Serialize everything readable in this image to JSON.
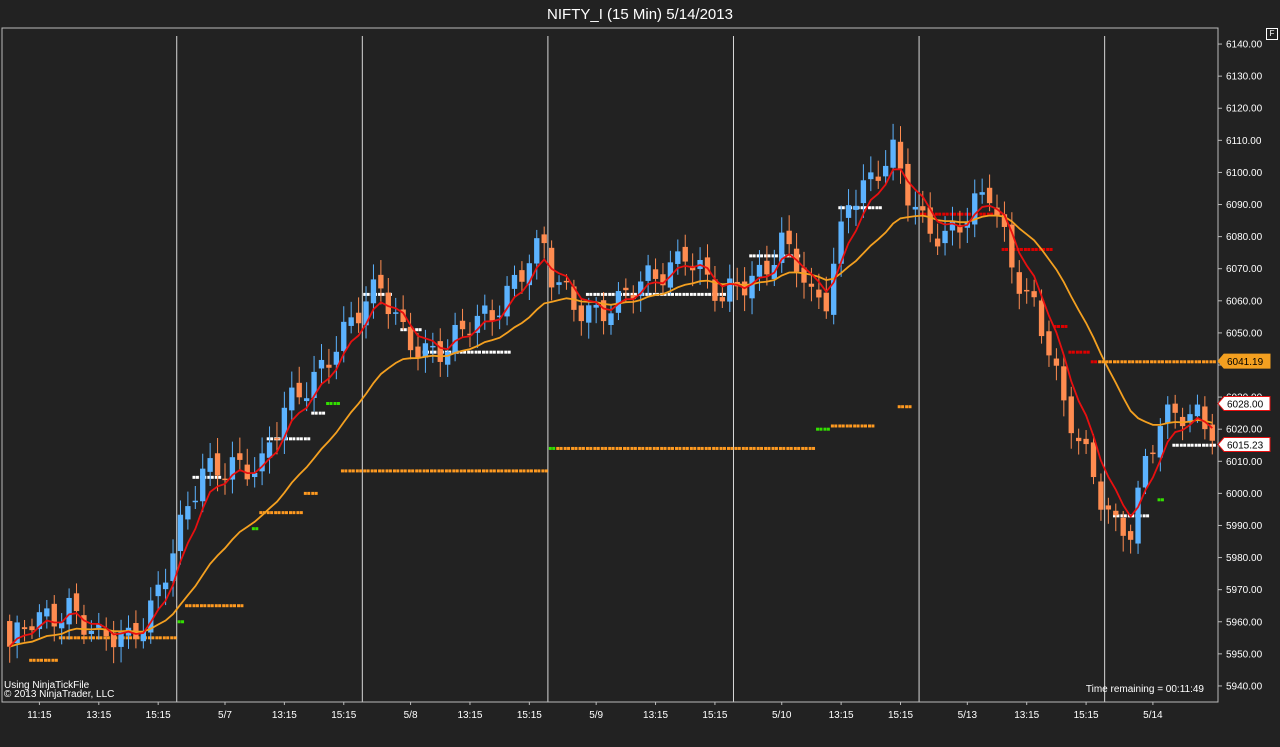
{
  "window": {
    "title": "NIFTY_I (15 Min)  5/14/2013",
    "f_button": "F"
  },
  "footer": {
    "source_line1": "Using NinjaTickFile",
    "source_line2": "© 2013 NinjaTrader, LLC",
    "time_remaining": "Time remaining = 00:11:49"
  },
  "colors": {
    "background": "#222222",
    "up_candle": "#5cb3ff",
    "down_candle": "#ff8c50",
    "ema_fast": "#e81010",
    "ema_slow": "#f4a020",
    "stop_white": "#ffffff",
    "stop_orange": "#ff9a20",
    "stop_green": "#33e000",
    "stop_red": "#e00000",
    "stop_magenta": "#e020e0"
  },
  "chart_data": {
    "type": "candlestick",
    "symbol": "NIFTY_I",
    "interval": "15 Min",
    "ylim": [
      5935,
      6145
    ],
    "y_ticks": [
      "6140.00",
      "6130.00",
      "6120.00",
      "6110.00",
      "6100.00",
      "6090.00",
      "6080.00",
      "6070.00",
      "6060.00",
      "6050.00",
      "6040.00",
      "6030.00",
      "6020.00",
      "6010.00",
      "6000.00",
      "5990.00",
      "5980.00",
      "5970.00",
      "5960.00",
      "5950.00",
      "5940.00"
    ],
    "x_labels": [
      {
        "bar": 4,
        "label": "11:15"
      },
      {
        "bar": 12,
        "label": "13:15"
      },
      {
        "bar": 20,
        "label": "15:15"
      },
      {
        "bar": 29,
        "label": "5/7"
      },
      {
        "bar": 37,
        "label": "13:15"
      },
      {
        "bar": 45,
        "label": "15:15"
      },
      {
        "bar": 54,
        "label": "5/8"
      },
      {
        "bar": 62,
        "label": "13:15"
      },
      {
        "bar": 70,
        "label": "15:15"
      },
      {
        "bar": 79,
        "label": "5/9"
      },
      {
        "bar": 87,
        "label": "13:15"
      },
      {
        "bar": 95,
        "label": "15:15"
      },
      {
        "bar": 104,
        "label": "5/10"
      },
      {
        "bar": 112,
        "label": "13:15"
      },
      {
        "bar": 120,
        "label": "15:15"
      },
      {
        "bar": 129,
        "label": "5/13"
      },
      {
        "bar": 137,
        "label": "13:15"
      },
      {
        "bar": 145,
        "label": "15:15"
      },
      {
        "bar": 154,
        "label": "5/14"
      }
    ],
    "session_breaks": [
      23,
      48,
      73,
      98,
      123,
      148
    ],
    "price_tags": [
      {
        "value": 6041.19,
        "label": "6041.19",
        "color": "#f4a020"
      },
      {
        "value": 6028.0,
        "label": "6028.00",
        "color": "#ffffff"
      },
      {
        "value": 6015.23,
        "label": "6015.23",
        "color": "#ffffff"
      }
    ],
    "key_points": [
      [
        0,
        5950
      ],
      [
        3,
        5960
      ],
      [
        8,
        5966
      ],
      [
        12,
        5953
      ],
      [
        16,
        5955
      ],
      [
        19,
        5966
      ],
      [
        22,
        5982
      ],
      [
        26,
        6005
      ],
      [
        30,
        6011
      ],
      [
        34,
        6008
      ],
      [
        37,
        6024
      ],
      [
        40,
        6034
      ],
      [
        44,
        6048
      ],
      [
        47,
        6055
      ],
      [
        50,
        6063
      ],
      [
        53,
        6052
      ],
      [
        56,
        6045
      ],
      [
        59,
        6043
      ],
      [
        62,
        6052
      ],
      [
        65,
        6058
      ],
      [
        68,
        6067
      ],
      [
        70,
        6072
      ],
      [
        72,
        6075
      ],
      [
        73,
        6066
      ],
      [
        76,
        6060
      ],
      [
        79,
        6058
      ],
      [
        82,
        6058
      ],
      [
        85,
        6064
      ],
      [
        88,
        6070
      ],
      [
        91,
        6077
      ],
      [
        94,
        6065
      ],
      [
        96,
        6058
      ],
      [
        98,
        6064
      ],
      [
        101,
        6070
      ],
      [
        104,
        6079
      ],
      [
        106,
        6071
      ],
      [
        108,
        6058
      ],
      [
        110,
        6060
      ],
      [
        113,
        6094
      ],
      [
        116,
        6098
      ],
      [
        119,
        6104
      ],
      [
        121,
        6092
      ],
      [
        123,
        6085
      ],
      [
        126,
        6082
      ],
      [
        129,
        6086
      ],
      [
        132,
        6092
      ],
      [
        135,
        6072
      ],
      [
        138,
        6060
      ],
      [
        140,
        6046
      ],
      [
        142,
        6025
      ],
      [
        145,
        6010
      ],
      [
        147,
        6000
      ],
      [
        149,
        5992
      ],
      [
        151,
        5990
      ],
      [
        153,
        6008
      ],
      [
        155,
        6020
      ],
      [
        158,
        6025
      ],
      [
        160,
        6026
      ],
      [
        162,
        6022
      ]
    ],
    "ema_fast_period": 5,
    "ema_slow_period": 20,
    "stop_segments": [
      {
        "from": 3,
        "to": 6,
        "value": 5948,
        "color": "#ff9a20"
      },
      {
        "from": 7,
        "to": 22,
        "value": 5955,
        "color": "#ff9a20"
      },
      {
        "from": 23,
        "to": 23,
        "value": 5960,
        "color": "#33e000"
      },
      {
        "from": 24,
        "to": 31,
        "value": 5965,
        "color": "#ff9a20"
      },
      {
        "from": 25,
        "to": 28,
        "value": 6005,
        "color": "#ffffff"
      },
      {
        "from": 33,
        "to": 33,
        "value": 5989,
        "color": "#33e000"
      },
      {
        "from": 34,
        "to": 39,
        "value": 5994,
        "color": "#ff9a20"
      },
      {
        "from": 40,
        "to": 41,
        "value": 6000,
        "color": "#ff9a20"
      },
      {
        "from": 35,
        "to": 40,
        "value": 6017,
        "color": "#ffffff"
      },
      {
        "from": 41,
        "to": 42,
        "value": 6025,
        "color": "#ffffff"
      },
      {
        "from": 43,
        "to": 44,
        "value": 6028,
        "color": "#33e000"
      },
      {
        "from": 45,
        "to": 72,
        "value": 6007,
        "color": "#ff9a20"
      },
      {
        "from": 48,
        "to": 51,
        "value": 6062,
        "color": "#ffffff"
      },
      {
        "from": 53,
        "to": 55,
        "value": 6051,
        "color": "#ffffff"
      },
      {
        "from": 56,
        "to": 67,
        "value": 6044,
        "color": "#ffffff"
      },
      {
        "from": 73,
        "to": 73,
        "value": 6014,
        "color": "#33e000"
      },
      {
        "from": 74,
        "to": 108,
        "value": 6014,
        "color": "#ff9a20"
      },
      {
        "from": 78,
        "to": 96,
        "value": 6062,
        "color": "#ffffff"
      },
      {
        "from": 100,
        "to": 106,
        "value": 6074,
        "color": "#ffffff"
      },
      {
        "from": 109,
        "to": 110,
        "value": 6020,
        "color": "#33e000"
      },
      {
        "from": 111,
        "to": 116,
        "value": 6021,
        "color": "#ff9a20"
      },
      {
        "from": 112,
        "to": 117,
        "value": 6089,
        "color": "#ffffff"
      },
      {
        "from": 120,
        "to": 121,
        "value": 6027,
        "color": "#ff9a20"
      },
      {
        "from": 123,
        "to": 133,
        "value": 6087,
        "color": "#e00000"
      },
      {
        "from": 134,
        "to": 140,
        "value": 6076,
        "color": "#e00000"
      },
      {
        "from": 141,
        "to": 142,
        "value": 6052,
        "color": "#e00000"
      },
      {
        "from": 143,
        "to": 145,
        "value": 6044,
        "color": "#e00000"
      },
      {
        "from": 146,
        "to": 146,
        "value": 6041,
        "color": "#e00000"
      },
      {
        "from": 147,
        "to": 162,
        "value": 6041,
        "color": "#ff9a20"
      },
      {
        "from": 149,
        "to": 153,
        "value": 5993,
        "color": "#ffffff"
      },
      {
        "from": 155,
        "to": 155,
        "value": 5998,
        "color": "#33e000"
      },
      {
        "from": 157,
        "to": 162,
        "value": 6015,
        "color": "#ffffff"
      }
    ]
  }
}
